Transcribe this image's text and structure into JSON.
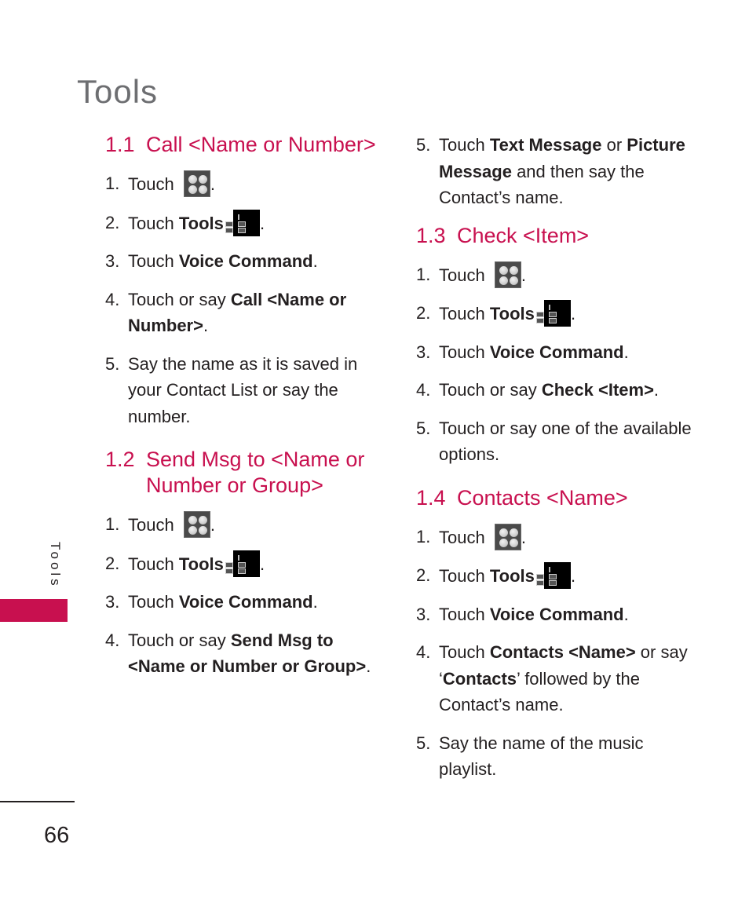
{
  "page": {
    "title": "Tools",
    "side_label": "Tools",
    "page_number": "66",
    "accent_color": "#c8104f"
  },
  "sections": {
    "s11": {
      "num": "1.1",
      "title": "Call <Name or Number>",
      "steps": [
        {
          "n": "1.",
          "pre": "Touch",
          "icon": "menu-grid-icon",
          "post": "."
        },
        {
          "n": "2.",
          "pre": "Touch ",
          "bold": "Tools",
          "icon": "tools-calculator-icon",
          "post": "."
        },
        {
          "n": "3.",
          "pre": "Touch ",
          "bold": "Voice Command",
          "post": "."
        },
        {
          "n": "4.",
          "pre": "Touch or say ",
          "bold": "Call <Name or Number>",
          "post": "."
        },
        {
          "n": "5.",
          "text": "Say the name as it is saved in your Contact List or say the number."
        }
      ]
    },
    "s12": {
      "num": "1.2",
      "title": "Send Msg to <Name or Number or Group>",
      "steps": [
        {
          "n": "1.",
          "pre": "Touch",
          "icon": "menu-grid-icon",
          "post": "."
        },
        {
          "n": "2.",
          "pre": "Touch ",
          "bold": "Tools",
          "icon": "tools-calculator-icon",
          "post": "."
        },
        {
          "n": "3.",
          "pre": "Touch ",
          "bold": "Voice Command",
          "post": "."
        },
        {
          "n": "4.",
          "pre": "Touch or say ",
          "bold": "Send Msg to <Name or Number or Group>",
          "post": "."
        },
        {
          "n": "5.",
          "pre": "Touch ",
          "bold": "Text Message",
          "mid": " or ",
          "bold2": "Picture Message",
          "post": " and then say the Contact’s name."
        }
      ]
    },
    "s13": {
      "num": "1.3",
      "title": "Check <Item>",
      "steps": [
        {
          "n": "1.",
          "pre": "Touch",
          "icon": "menu-grid-icon",
          "post": "."
        },
        {
          "n": "2.",
          "pre": "Touch ",
          "bold": "Tools",
          "icon": "tools-calculator-icon",
          "post": "."
        },
        {
          "n": "3.",
          "pre": "Touch ",
          "bold": "Voice Command",
          "post": "."
        },
        {
          "n": "4.",
          "pre": "Touch or say ",
          "bold": "Check <Item>",
          "post": "."
        },
        {
          "n": "5.",
          "text": "Touch or say one of the available options."
        }
      ]
    },
    "s14": {
      "num": "1.4",
      "title": "Contacts <Name>",
      "steps": [
        {
          "n": "1.",
          "pre": "Touch",
          "icon": "menu-grid-icon",
          "post": "."
        },
        {
          "n": "2.",
          "pre": "Touch ",
          "bold": "Tools",
          "icon": "tools-calculator-icon",
          "post": "."
        },
        {
          "n": "3.",
          "pre": "Touch ",
          "bold": "Voice Command",
          "post": "."
        },
        {
          "n": "4.",
          "pre": "Touch ",
          "bold": "Contacts <Name>",
          "mid": " or say ‘",
          "bold2": "Contacts",
          "post": "’ followed by the Contact’s name."
        },
        {
          "n": "5.",
          "text": "Say the name of the music playlist."
        }
      ]
    }
  }
}
